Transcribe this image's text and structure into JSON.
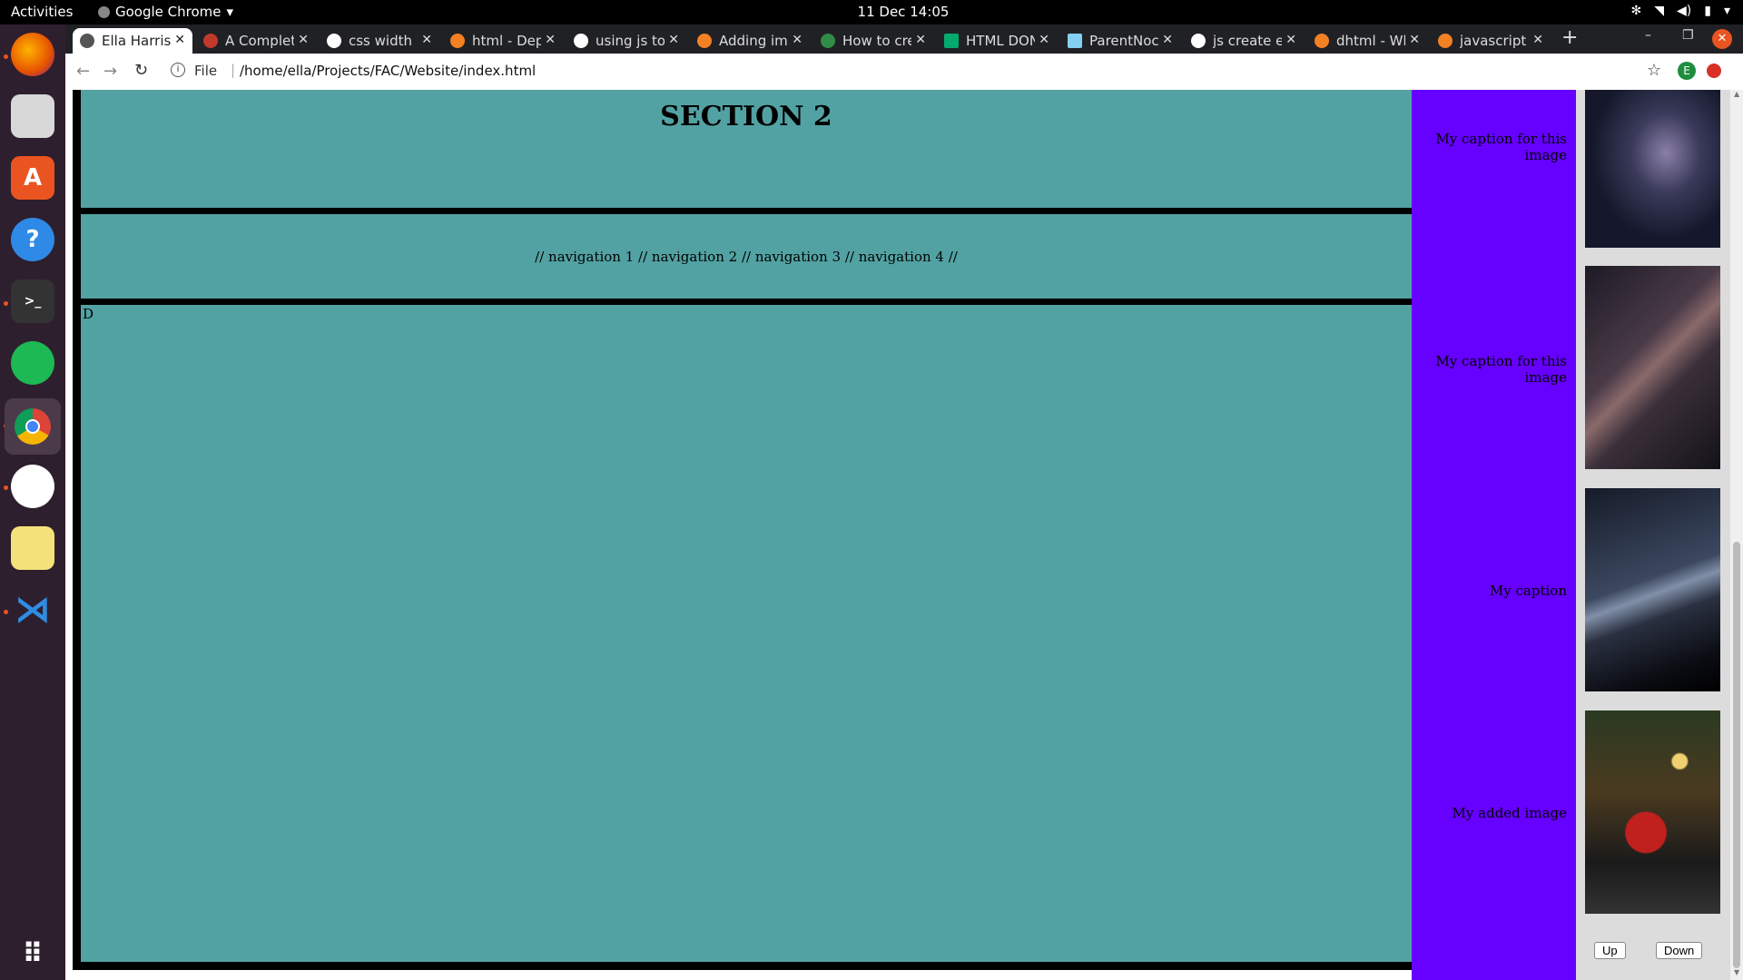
{
  "topbar": {
    "activities": "Activities",
    "app_name": "Google Chrome",
    "clock": "11 Dec  14:05"
  },
  "browser": {
    "tabs": [
      {
        "title": "Ella Harris",
        "active": true
      },
      {
        "title": "A Complet",
        "active": false
      },
      {
        "title": "css width",
        "active": false
      },
      {
        "title": "html - Dep",
        "active": false
      },
      {
        "title": "using js to",
        "active": false
      },
      {
        "title": "Adding im",
        "active": false
      },
      {
        "title": "How to cre",
        "active": false
      },
      {
        "title": "HTML DON",
        "active": false
      },
      {
        "title": "ParentNoc",
        "active": false
      },
      {
        "title": "js create el",
        "active": false
      },
      {
        "title": "dhtml - Wh",
        "active": false
      },
      {
        "title": "javascript",
        "active": false
      }
    ],
    "scheme_label": "File",
    "url": "/home/ella/Projects/FAC/Website/index.html",
    "profile_initial": "E"
  },
  "page": {
    "section_title": "SECTION 2",
    "nav_text": "// navigation 1 // navigation 2 // navigation 3 // navigation 4 //",
    "content_text": "D",
    "captions": [
      "My caption for this image",
      "My caption for this image",
      "My caption",
      "My added image"
    ],
    "up_button": "Up",
    "down_button": "Down"
  },
  "colors": {
    "section_bg": "#53a2a3",
    "sidebar_bg": "#6600ff",
    "dock_bg": "#2e1f2e"
  }
}
